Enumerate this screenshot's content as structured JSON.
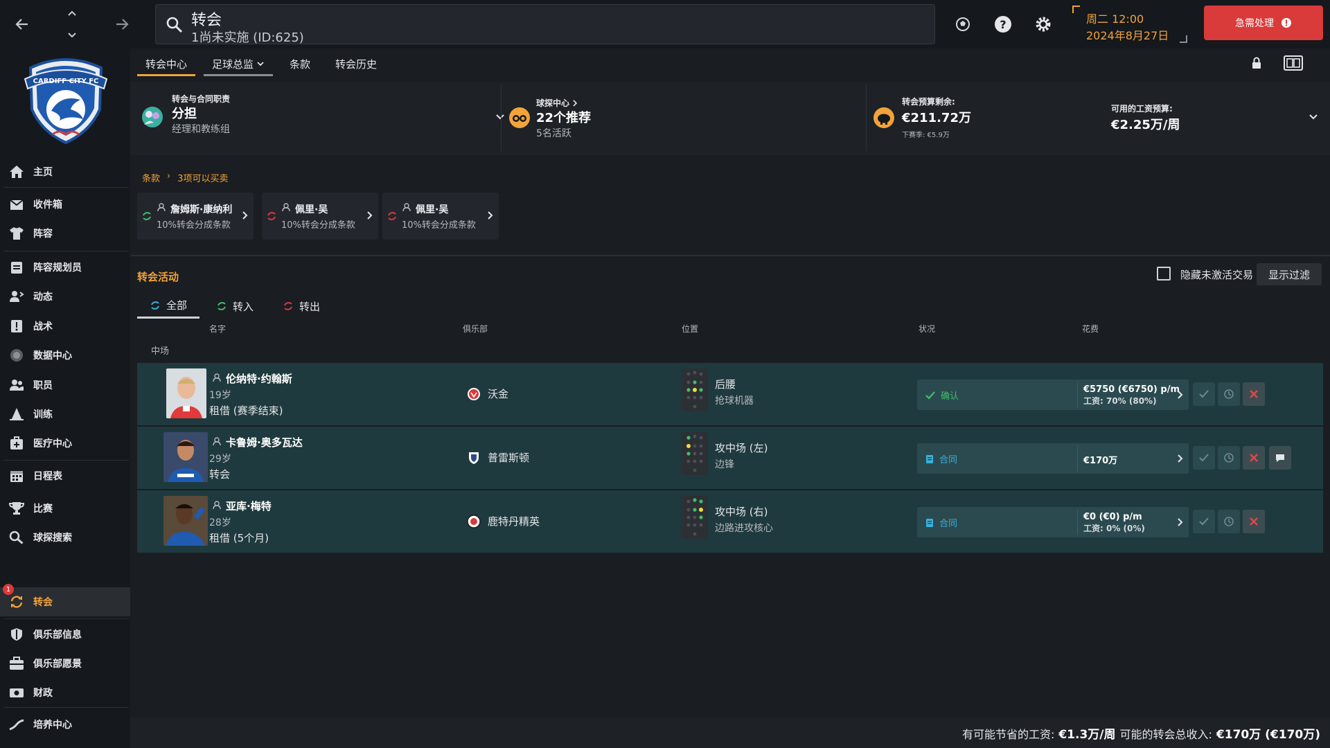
{
  "search": {
    "title": "转会",
    "subtitle": "1尚未实施 (ID:625)"
  },
  "datetime": {
    "day_time": "周二 12:00",
    "date": "2024年8月27日"
  },
  "urgent": {
    "label": "急需处理"
  },
  "sidebar": {
    "items": [
      {
        "label": "主页",
        "icon": "home-icon"
      },
      {
        "label": "收件箱",
        "icon": "inbox-icon"
      },
      {
        "label": "阵容",
        "icon": "shirt-icon"
      },
      {
        "label": "阵容规划员",
        "icon": "clipboard-icon"
      },
      {
        "label": "动态",
        "icon": "dynamics-icon"
      },
      {
        "label": "战术",
        "icon": "tactics-icon"
      },
      {
        "label": "数据中心",
        "icon": "data-icon"
      },
      {
        "label": "职员",
        "icon": "staff-icon"
      },
      {
        "label": "训练",
        "icon": "training-icon"
      },
      {
        "label": "医疗中心",
        "icon": "medical-icon"
      },
      {
        "label": "日程表",
        "icon": "calendar-icon"
      },
      {
        "label": "比赛",
        "icon": "trophy-icon"
      },
      {
        "label": "球探搜索",
        "icon": "scout-search-icon"
      },
      {
        "label": "转会",
        "icon": "transfer-icon",
        "badge": "1"
      },
      {
        "label": "俱乐部信息",
        "icon": "shield-icon"
      },
      {
        "label": "俱乐部愿景",
        "icon": "vision-icon"
      },
      {
        "label": "财政",
        "icon": "finance-icon"
      },
      {
        "label": "培养中心",
        "icon": "development-icon"
      }
    ],
    "crest_text": "CARDIFF CITY FC"
  },
  "tabs": [
    {
      "label": "转会中心"
    },
    {
      "label": "足球总监"
    },
    {
      "label": "条款"
    },
    {
      "label": "转会历史"
    }
  ],
  "summary": {
    "responsibility": {
      "label": "转会与合同职责",
      "value": "分担",
      "sub": "经理和教练组"
    },
    "scouting": {
      "label": "球探中心",
      "value": "22个推荐",
      "sub": "5名活跃"
    },
    "budget": {
      "label": "转会预算剩余:",
      "value": "€211.72万",
      "sub": "下赛季: €5.9万"
    },
    "wage": {
      "label": "可用的工资预算:",
      "value": "€2.25万/周"
    }
  },
  "clauses": {
    "crumb_root": "条款",
    "crumb_current": "3项可以买卖",
    "items": [
      {
        "name": "詹姆斯·康纳利",
        "desc": "10%转会分成条款",
        "dir": "in"
      },
      {
        "name": "佩里·吴",
        "desc": "10%转会分成条款",
        "dir": "out"
      },
      {
        "name": "佩里·吴",
        "desc": "10%转会分成条款",
        "dir": "out"
      }
    ]
  },
  "activity": {
    "title": "转会活动",
    "hide_label": "隐藏未激活交易",
    "filter_label": "显示过滤",
    "tabs": [
      {
        "label": "全部"
      },
      {
        "label": "转入"
      },
      {
        "label": "转出"
      }
    ],
    "columns": {
      "name": "名字",
      "club": "俱乐部",
      "position": "位置",
      "status": "状况",
      "fee": "花费"
    },
    "group": "中场",
    "rows": [
      {
        "name": "伦纳特·约翰斯",
        "age": "19岁",
        "deal": "租借 (赛季结束)",
        "club": "沃金",
        "position": "后腰",
        "role": "抢球机器",
        "status": "确认",
        "fee1": "€5750 (€6750) p/m",
        "fee2": "工资: 70% (80%)"
      },
      {
        "name": "卡鲁姆·奥多瓦达",
        "age": "29岁",
        "deal": "转会",
        "club": "普雷斯顿",
        "position": "攻中场 (左)",
        "role": "边锋",
        "status": "合同",
        "fee1": "€170万",
        "fee2": ""
      },
      {
        "name": "亚库·梅特",
        "age": "28岁",
        "deal": "租借 (5个月)",
        "club": "鹿特丹精英",
        "position": "攻中场 (右)",
        "role": "边路进攻核心",
        "status": "合同",
        "fee1": "€0 (€0) p/m",
        "fee2": "工资: 0% (0%)"
      }
    ]
  },
  "footer": {
    "wage_label": "有可能节省的工资:",
    "wage_value": "€1.3万/周",
    "income_label": "可能的转会总收入:",
    "income_value": "€170万 (€170万)"
  },
  "colors": {
    "accent": "#f2a33a",
    "danger": "#d93a3a",
    "row_bg": "#1f3a3e",
    "confirm": "#3fbf6a",
    "contract": "#3ab0d9"
  }
}
